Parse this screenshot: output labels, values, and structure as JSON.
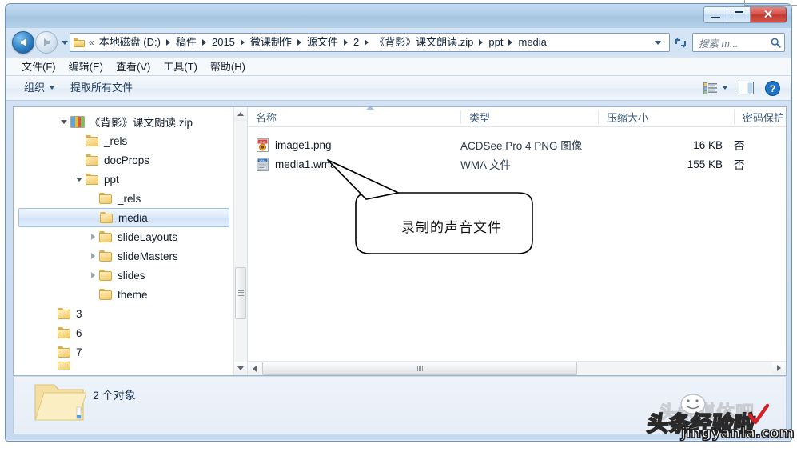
{
  "window": {
    "controls": {
      "minimize_label": "–",
      "maximize_label": "",
      "close_label": "✕"
    }
  },
  "address": {
    "back_tooltip": "后退",
    "forward_tooltip": "前进",
    "overflow_chevrons": "«",
    "breadcrumbs": [
      "本地磁盘 (D:)",
      "稿件",
      "2015",
      "微课制作",
      "源文件",
      "2",
      "《背影》课文朗读.zip",
      "ppt",
      "media"
    ]
  },
  "search": {
    "placeholder": "搜索 m..."
  },
  "menu": {
    "items": [
      "文件(F)",
      "编辑(E)",
      "查看(V)",
      "工具(T)",
      "帮助(H)"
    ]
  },
  "command_bar": {
    "organize_label": "组织",
    "extract_all_label": "提取所有文件"
  },
  "nav_pane": {
    "items": [
      {
        "label": "《背影》课文朗读.zip",
        "indent": 1,
        "twisty": "expanded",
        "icon": "zip-icon",
        "selected": false
      },
      {
        "label": "_rels",
        "indent": 2,
        "twisty": "none",
        "icon": "folder-icon",
        "selected": false
      },
      {
        "label": "docProps",
        "indent": 2,
        "twisty": "none",
        "icon": "folder-icon",
        "selected": false
      },
      {
        "label": "ppt",
        "indent": 1.6,
        "twisty": "expanded",
        "icon": "folder-icon",
        "selected": false
      },
      {
        "label": "_rels",
        "indent": 2.6,
        "twisty": "none",
        "icon": "folder-icon",
        "selected": false
      },
      {
        "label": "media",
        "indent": 2.6,
        "twisty": "none",
        "icon": "folder-icon",
        "selected": true
      },
      {
        "label": "slideLayouts",
        "indent": 2.6,
        "twisty": "collapsed",
        "icon": "folder-icon",
        "selected": false
      },
      {
        "label": "slideMasters",
        "indent": 2.6,
        "twisty": "collapsed",
        "icon": "folder-icon",
        "selected": false
      },
      {
        "label": "slides",
        "indent": 2.6,
        "twisty": "collapsed",
        "icon": "folder-icon",
        "selected": false
      },
      {
        "label": "theme",
        "indent": 2.6,
        "twisty": "none",
        "icon": "folder-icon",
        "selected": false
      },
      {
        "label": "3",
        "indent": 1,
        "twisty": "none",
        "icon": "folder-icon",
        "selected": false
      },
      {
        "label": "6",
        "indent": 1,
        "twisty": "none",
        "icon": "folder-icon",
        "selected": false
      },
      {
        "label": "7",
        "indent": 1,
        "twisty": "none",
        "icon": "folder-icon",
        "selected": false
      }
    ]
  },
  "file_list": {
    "columns": [
      "名称",
      "类型",
      "压缩大小",
      "密码保护"
    ],
    "rows": [
      {
        "name": "image1.png",
        "type": "ACDSee Pro 4 PNG 图像",
        "size": "16 KB",
        "password_protected": "否",
        "icon": "png-image-icon"
      },
      {
        "name": "media1.wma",
        "type": "WMA 文件",
        "size": "155 KB",
        "password_protected": "否",
        "icon": "wma-audio-icon"
      }
    ]
  },
  "annotation": {
    "callout_text": "录制的声音文件"
  },
  "status_bar": {
    "text": "2 个对象"
  },
  "watermark": {
    "background_text": "头条媒体吧",
    "main_text": "头条经验啦",
    "url_text": "jingyanla.com"
  },
  "colors": {
    "accent_blue": "#2f7fc4",
    "close_red": "#bf3a31",
    "selection_blue": "#9cc3e8",
    "titlebar_blue": "#a4c4e0",
    "folder_yellow": "#f0ca66"
  }
}
